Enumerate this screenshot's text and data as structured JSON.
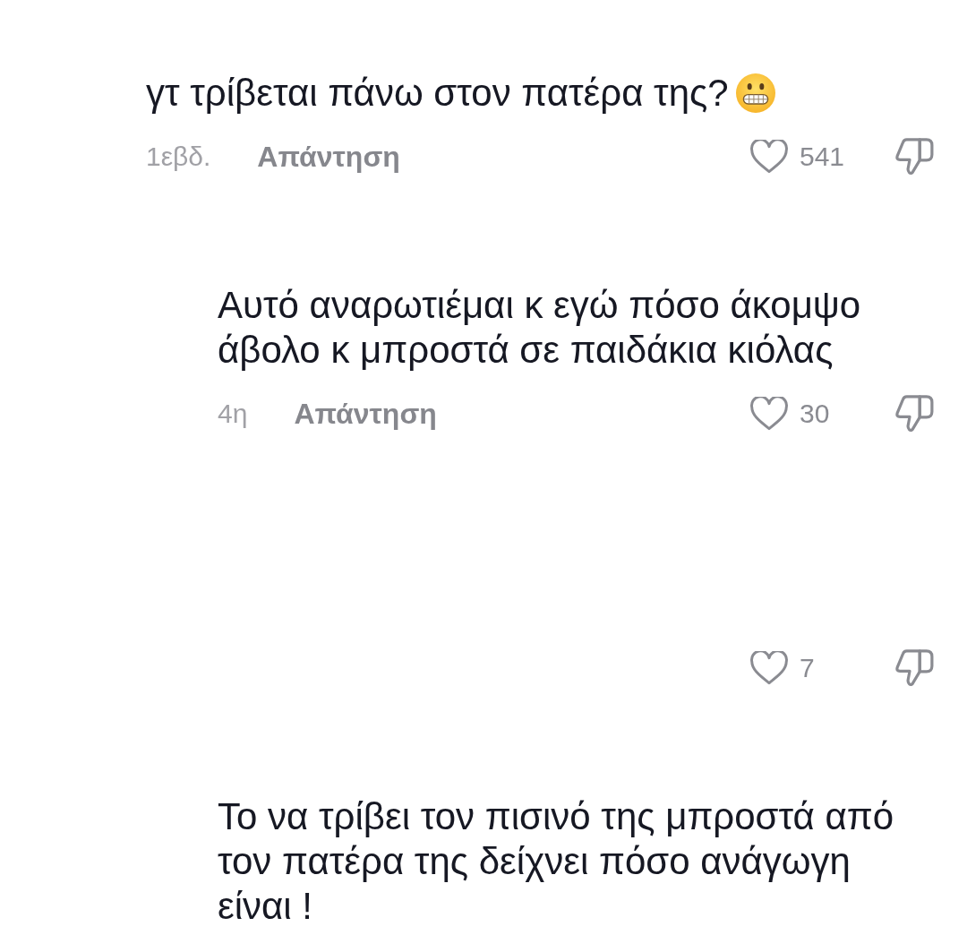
{
  "comments": [
    {
      "text_lines": [
        "γτ τρίβεται πάνω στον πατέρα της?"
      ],
      "emoji": true,
      "time": "1εβδ.",
      "reply_label": "Απάντηση",
      "likes": "541",
      "children": [
        {
          "text_lines": [
            "Αυτό αναρωτιέμαι κ εγώ πόσο άκομψο",
            "άβολο κ μπροστά σε παιδάκια κιόλας"
          ],
          "time": "4η",
          "reply_label": "Απάντηση",
          "likes": "30"
        },
        {
          "likes": "7"
        },
        {
          "text_lines": [
            "Το να τρίβει τον πισινό της μπροστά από",
            "τον πατέρα της δείχνει πόσο ανάγωγη",
            "είναι !"
          ]
        }
      ]
    }
  ]
}
